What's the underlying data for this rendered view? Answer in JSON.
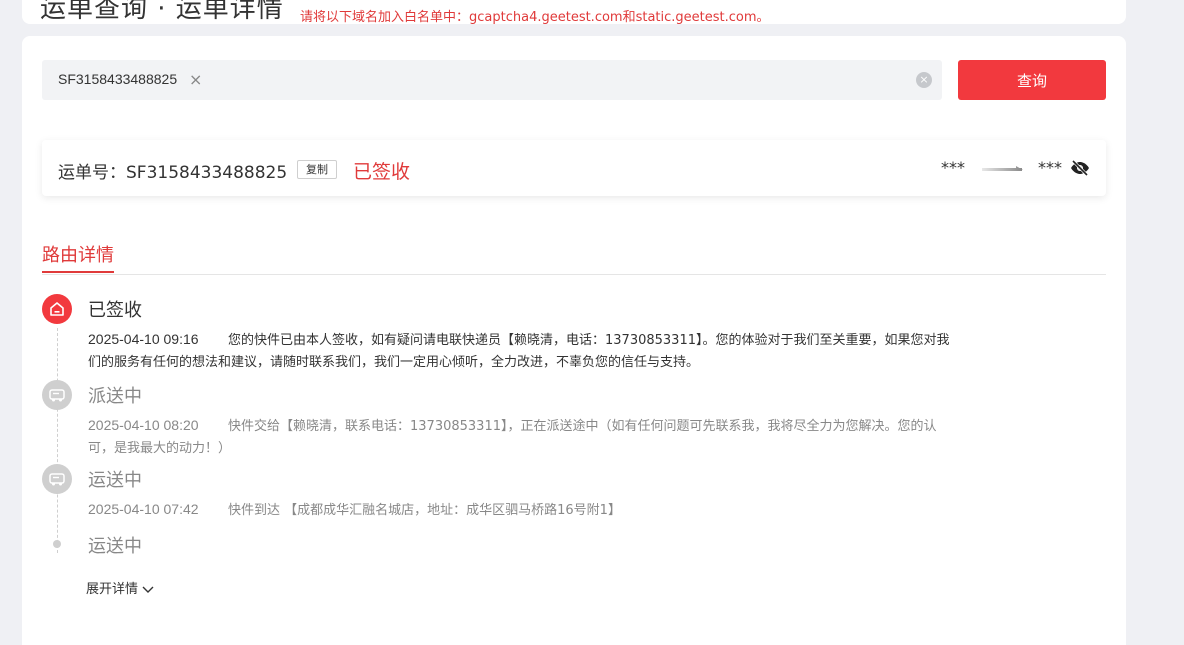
{
  "header": {
    "breadcrumb": "运单查询 · 运单详情",
    "notice": "请将以下域名加入白名单中：gcaptcha4.geetest.com和static.geetest.com。"
  },
  "search": {
    "tag_value": "SF3158433488825",
    "tag_close": "×",
    "clear": "×",
    "button_label": "查询"
  },
  "waybill": {
    "label": "运单号：SF3158433488825",
    "copy_label": "复制",
    "status": "已签收",
    "origin": "***",
    "destination": "***"
  },
  "tabs": {
    "route_detail": "路由详情"
  },
  "timeline": [
    {
      "title": "已签收",
      "time": "2025-04-10 09:16",
      "text": "您的快件已由本人签收，如有疑问请电联快递员【赖晓清，电话：13730853311】。您的体验对于我们至关重要，如果您对我们的服务有任何的想法和建议，请随时联系我们，我们一定用心倾听，全力改进，不辜负您的信任与支持。",
      "icon": "home-icon"
    },
    {
      "title": "派送中",
      "time": "2025-04-10 08:20",
      "text": "快件交给【赖晓清，联系电话：13730853311】，正在派送途中（如有任何问题可先联系我，我将尽全力为您解决。您的认可，是我最大的动力！）",
      "icon": "truck-icon"
    },
    {
      "title": "运送中",
      "time": "2025-04-10 07:42",
      "text": "快件到达 【成都成华汇融名城店，地址：成华区驷马桥路16号附1】",
      "icon": "truck-icon"
    },
    {
      "title": "运送中",
      "icon": "dot-icon"
    }
  ],
  "expand_label": "展开详情",
  "colors": {
    "accent": "#f2393e",
    "status_red": "#e03a3a",
    "page_bg": "#eff0f4",
    "inactive_gray": "#cfcfcf"
  }
}
